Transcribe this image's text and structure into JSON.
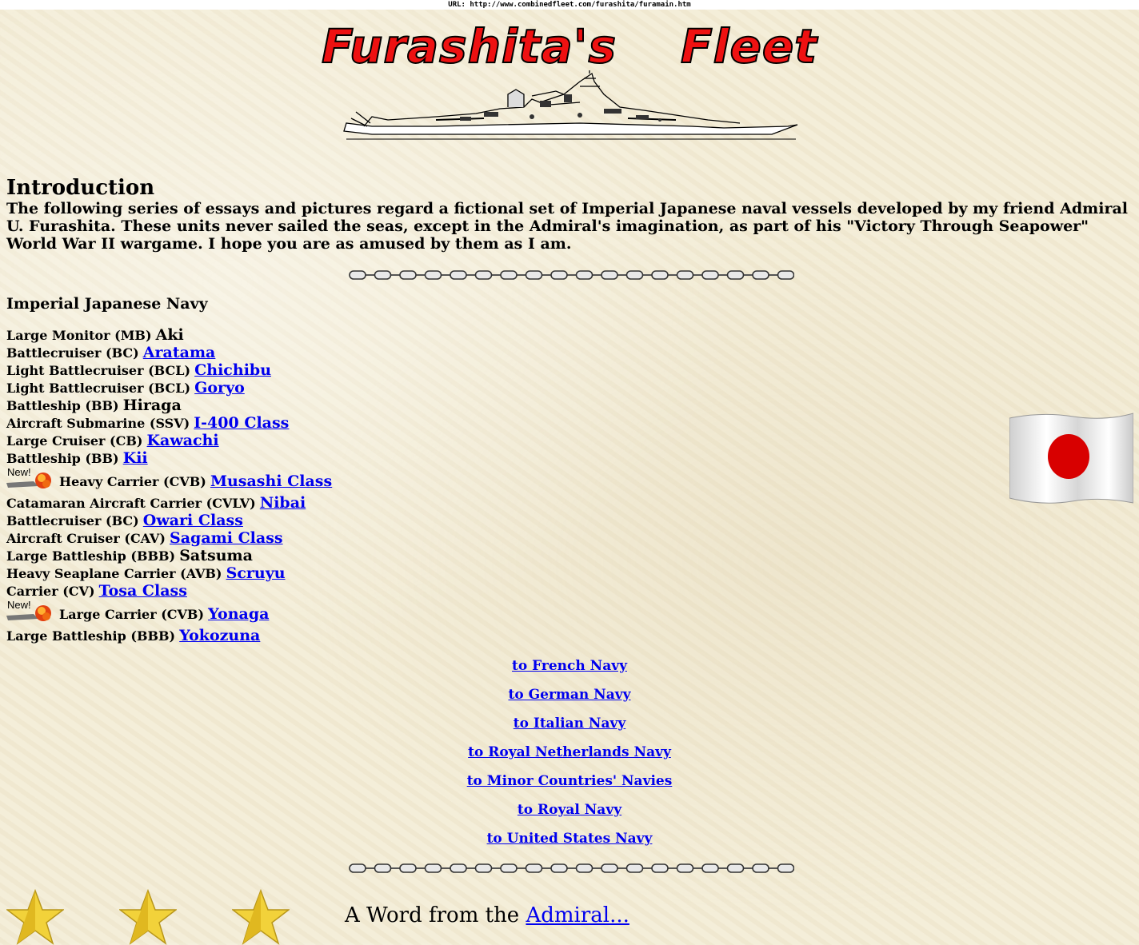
{
  "url_bar": "URL: http://www.combinedfleet.com/furashita/furamain.htm",
  "title": {
    "part1": "Furashita's",
    "part2": "Fleet"
  },
  "intro": {
    "heading": "Introduction",
    "text": "The following series of essays and pictures regard a fictional set of Imperial Japanese naval vessels developed by my friend Admiral U. Furashita. These units never sailed the seas, except in the Admiral's imagination, as part of his \"Victory Through Seapower\" World War II wargame. I hope you are as amused by them as I am."
  },
  "navy_heading": "Imperial Japanese Navy",
  "new_badge": "New!",
  "ships": [
    {
      "kind": "Large Monitor (MB)",
      "name": "Aki",
      "link": false,
      "new": false
    },
    {
      "kind": "Battlecruiser (BC)",
      "name": "Aratama",
      "link": true,
      "new": false
    },
    {
      "kind": "Light Battlecruiser (BCL)",
      "name": "Chichibu",
      "link": true,
      "new": false
    },
    {
      "kind": "Light Battlecruiser (BCL)",
      "name": "Goryo",
      "link": true,
      "new": false
    },
    {
      "kind": "Battleship (BB)",
      "name": "Hiraga",
      "link": false,
      "new": false
    },
    {
      "kind": "Aircraft Submarine (SSV)",
      "name": "I-400 Class",
      "link": true,
      "new": false
    },
    {
      "kind": "Large Cruiser (CB)",
      "name": "Kawachi",
      "link": true,
      "new": false
    },
    {
      "kind": "Battleship (BB)",
      "name": "Kii",
      "link": true,
      "new": false
    },
    {
      "kind": "Heavy Carrier (CVB)",
      "name": "Musashi Class",
      "link": true,
      "new": true
    },
    {
      "kind": "Catamaran Aircraft Carrier (CVLV)",
      "name": "Nibai",
      "link": true,
      "new": false
    },
    {
      "kind": "Battlecruiser (BC)",
      "name": "Owari Class",
      "link": true,
      "new": false
    },
    {
      "kind": "Aircraft Cruiser (CAV)",
      "name": "Sagami Class",
      "link": true,
      "new": false
    },
    {
      "kind": "Large Battleship (BBB)",
      "name": "Satsuma",
      "link": false,
      "new": false
    },
    {
      "kind": "Heavy Seaplane Carrier (AVB)",
      "name": "Scruyu",
      "link": true,
      "new": false
    },
    {
      "kind": "Carrier (CV)",
      "name": "Tosa Class",
      "link": true,
      "new": false
    },
    {
      "kind": "Large Carrier (CVB)",
      "name": "Yonaga",
      "link": true,
      "new": true
    },
    {
      "kind": "Large Battleship (BBB)",
      "name": "Yokozuna",
      "link": true,
      "new": false
    }
  ],
  "nav_links": [
    "to French Navy",
    "to German Navy",
    "to Italian Navy",
    "to Royal Netherlands Navy",
    "to Minor Countries' Navies",
    "to Royal Navy",
    "to United States Navy"
  ],
  "word": {
    "prefix": "A Word from the",
    "link": "Admiral..."
  },
  "colors": {
    "title_red": "#ee1111",
    "link_blue": "#0000ee",
    "star_gold": "#f2d23a",
    "flag_red": "#d80000"
  },
  "icons": [
    "battleship-drawing",
    "chain-divider",
    "japanese-flag",
    "gold-star",
    "new-badge"
  ]
}
